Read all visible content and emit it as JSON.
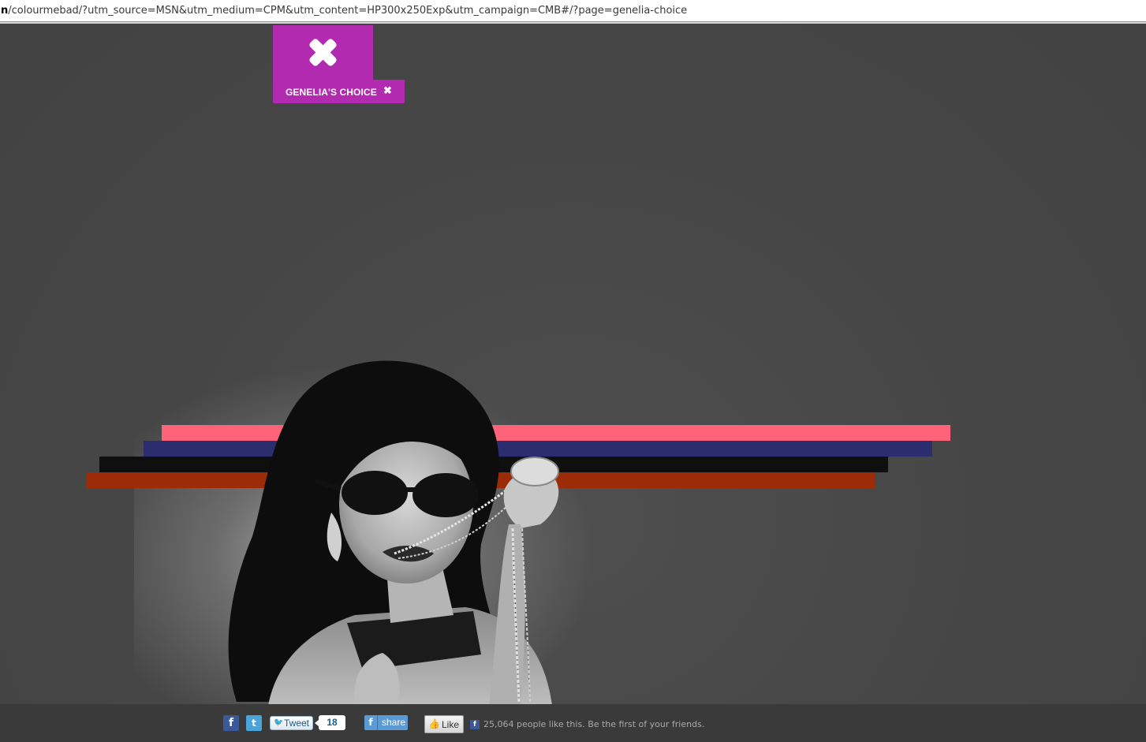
{
  "browser": {
    "url_prefix": "n",
    "url_rest": "/colourmebad/?utm_source=MSN&utm_medium=CPM&utm_content=HP300x250Exp&utm_campaign=CMB#/?page=genelia-choice"
  },
  "menu": {
    "box_icon": "close-x-icon",
    "tab_label": "GENELIA'S CHOICE",
    "tab_close_glyph": "✖",
    "accent_color": "#b12ab0"
  },
  "stripes": {
    "colors": [
      "#ff6379",
      "#2c2d6e",
      "#0f0f10",
      "#9c2c08"
    ]
  },
  "footer": {
    "facebook_icon_label": "f",
    "twitter_icon_label": "t",
    "tweet_label": "Tweet",
    "tweet_count": "18",
    "share_icon_label": "f",
    "share_label": "share",
    "like_label": "Like",
    "like_text": "25,064 people like this. Be the first of your friends."
  }
}
